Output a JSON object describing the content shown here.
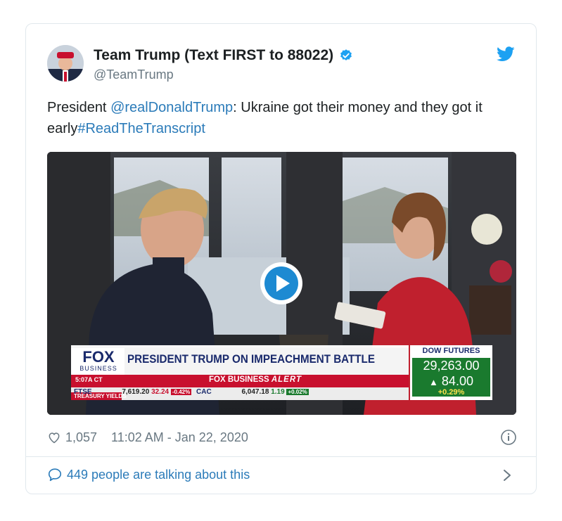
{
  "tweet": {
    "display_name": "Team Trump (Text FIRST to 88022)",
    "handle": "@TeamTrump",
    "text_prefix": "President ",
    "mention": "@realDonaldTrump",
    "text_middle": ": Ukraine got their money and they got it early",
    "hashtag": "#ReadTheTranscript",
    "likes": "1,057",
    "timestamp": "11:02 AM - Jan 22, 2020",
    "talking": "449 people are talking about this"
  },
  "video": {
    "network": "FOX",
    "network_sub": "BUSINESS",
    "time_code": "5:07A CT",
    "headline": "PRESIDENT TRUMP ON IMPEACHMENT BATTLE",
    "alert_label": "FOX BUSINESS",
    "alert_word": "ALERT",
    "ticker": {
      "ftse_label": "FTSE",
      "ftse_value": "7,619.20",
      "ftse_change": "32.24",
      "ftse_pct": "-0.42%",
      "cac_label": "CAC",
      "cac_value": "6,047.18",
      "cac_change": "1.19",
      "cac_pct": "+0.02%",
      "treasury": "TREASURY YIELDS"
    },
    "dow": {
      "label": "DOW FUTURES",
      "value": "29,263.00",
      "change": "84.00",
      "pct": "+0.29%"
    }
  },
  "colors": {
    "link": "#2b7bb9",
    "verified": "#1da1f2",
    "fox_blue": "#1a2a6c",
    "fox_red": "#c8102e",
    "dow_green": "#1a7a2e"
  },
  "icons": [
    "verified-icon",
    "twitter-bird-icon",
    "heart-icon",
    "info-icon",
    "comment-icon",
    "chevron-right-icon",
    "play-icon"
  ]
}
